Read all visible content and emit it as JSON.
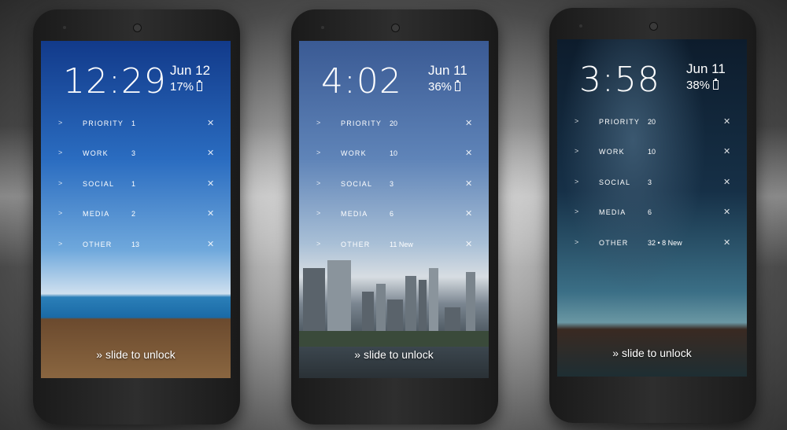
{
  "phones": [
    {
      "time": "12:29",
      "date": "Jun 12",
      "battery": "17%",
      "unlock": "» slide to unlock",
      "rows": [
        {
          "label": "PRIORITY",
          "count": "1"
        },
        {
          "label": "WORK",
          "count": "3"
        },
        {
          "label": "SOCIAL",
          "count": "1"
        },
        {
          "label": "MEDIA",
          "count": "2"
        },
        {
          "label": "OTHER",
          "count": "13"
        }
      ]
    },
    {
      "time": "4:02",
      "date": "Jun 11",
      "battery": "36%",
      "unlock": "» slide to unlock",
      "rows": [
        {
          "label": "PRIORITY",
          "count": "20"
        },
        {
          "label": "WORK",
          "count": "10"
        },
        {
          "label": "SOCIAL",
          "count": "3"
        },
        {
          "label": "MEDIA",
          "count": "6"
        },
        {
          "label": "OTHER",
          "count": "11 New"
        }
      ]
    },
    {
      "time": "3:58",
      "date": "Jun 11",
      "battery": "38%",
      "unlock": "» slide to unlock",
      "rows": [
        {
          "label": "PRIORITY",
          "count": "20"
        },
        {
          "label": "WORK",
          "count": "10"
        },
        {
          "label": "SOCIAL",
          "count": "3"
        },
        {
          "label": "MEDIA",
          "count": "6"
        },
        {
          "label": "OTHER",
          "count": "32 • 8 New"
        }
      ]
    }
  ],
  "icons": {
    "expand": "chevron-right-icon",
    "dismiss": "close-icon",
    "battery": "battery-icon"
  }
}
